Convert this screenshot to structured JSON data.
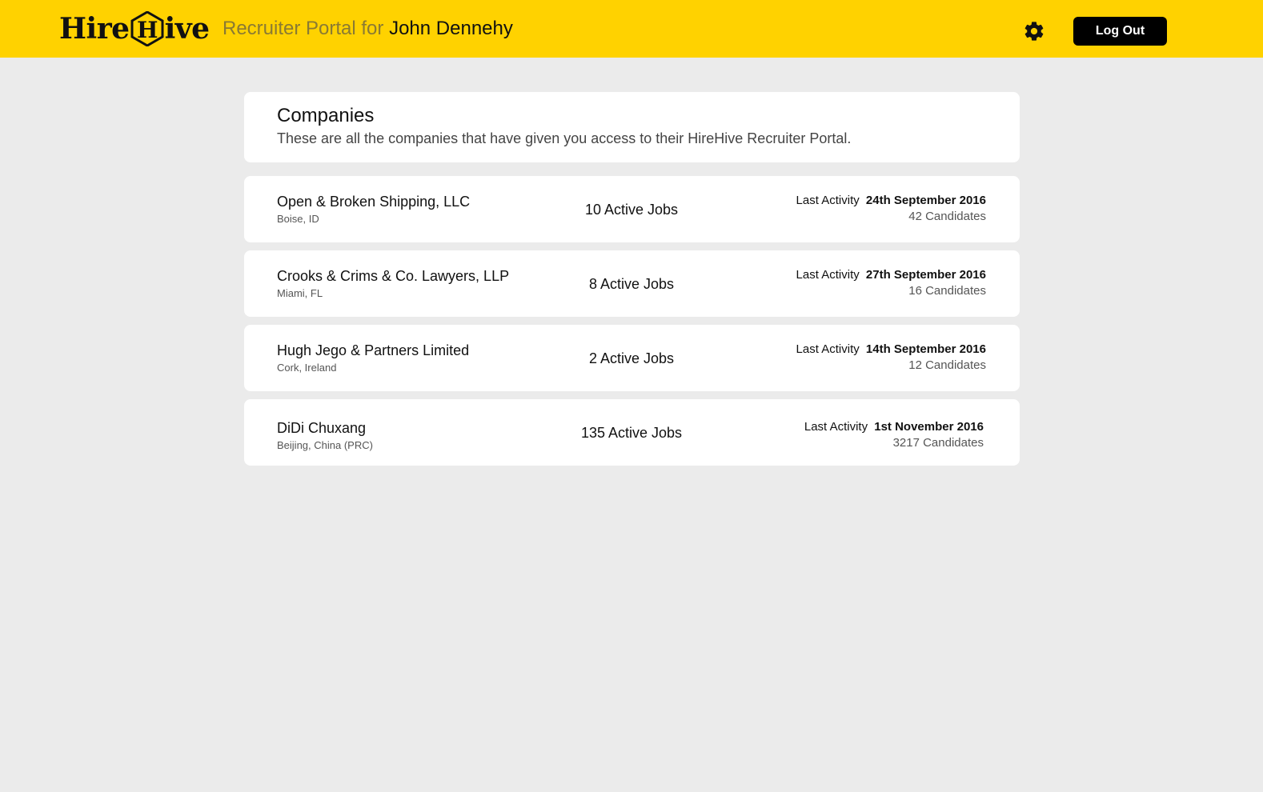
{
  "header": {
    "logo_left": "Hire",
    "logo_hex_letter": "H",
    "logo_right": "ive",
    "portal_prefix": "Recruiter Portal for",
    "user_name": "John Dennehy",
    "settings_icon": "gear-icon",
    "logout_label": "Log Out",
    "brand_color": "#ffd200"
  },
  "intro": {
    "title": "Companies",
    "description": "These are all the companies that have given you access to their HireHive Recruiter Portal."
  },
  "companies": [
    {
      "name": "Open & Broken Shipping, LLC",
      "location": "Boise, ID",
      "active_jobs": "10 Active Jobs",
      "last_activity_label": "Last Activity",
      "last_activity_date": "24th September 2016",
      "candidates": "42 Candidates"
    },
    {
      "name": "Crooks & Crims & Co. Lawyers, LLP",
      "location": "Miami, FL",
      "active_jobs": "8 Active Jobs",
      "last_activity_label": "Last Activity",
      "last_activity_date": "27th September 2016",
      "candidates": "16 Candidates"
    },
    {
      "name": "Hugh Jego & Partners Limited",
      "location": "Cork, Ireland",
      "active_jobs": "2 Active Jobs",
      "last_activity_label": "Last Activity",
      "last_activity_date": "14th September 2016",
      "candidates": "12 Candidates"
    },
    {
      "name": "DiDi Chuxang",
      "location": "Beijing, China (PRC)",
      "active_jobs": "135 Active Jobs",
      "last_activity_label": "Last Activity",
      "last_activity_date": "1st November 2016",
      "candidates": "3217 Candidates"
    }
  ]
}
